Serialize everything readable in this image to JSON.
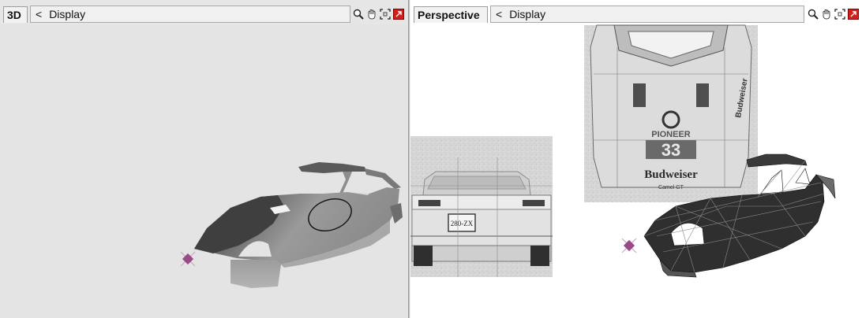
{
  "left_view": {
    "label": "3D",
    "display_menu": {
      "chevron": "<",
      "label": "Display"
    },
    "tools": [
      "zoom-icon",
      "pan-hand-icon",
      "frame-icon",
      "maximize-icon"
    ]
  },
  "right_view": {
    "label": "Perspective",
    "display_menu": {
      "chevron": "<",
      "label": "Display"
    },
    "tools": [
      "zoom-icon",
      "pan-hand-icon",
      "frame-icon",
      "maximize-icon"
    ],
    "reference_images": {
      "top_sheet": {
        "brand_text": "Budweiser",
        "sponsor_text": "PIONEER",
        "number": "33",
        "side_text": "Budweiser",
        "footer_text": "Camel GT"
      },
      "rear_sheet": {
        "plate_text": "280-ZX"
      }
    }
  },
  "colors": {
    "left_bg": "#e4e4e4",
    "right_bg": "#ffffff",
    "maximize_red": "#d81b1b",
    "pivot_magenta": "#9a4a86"
  }
}
